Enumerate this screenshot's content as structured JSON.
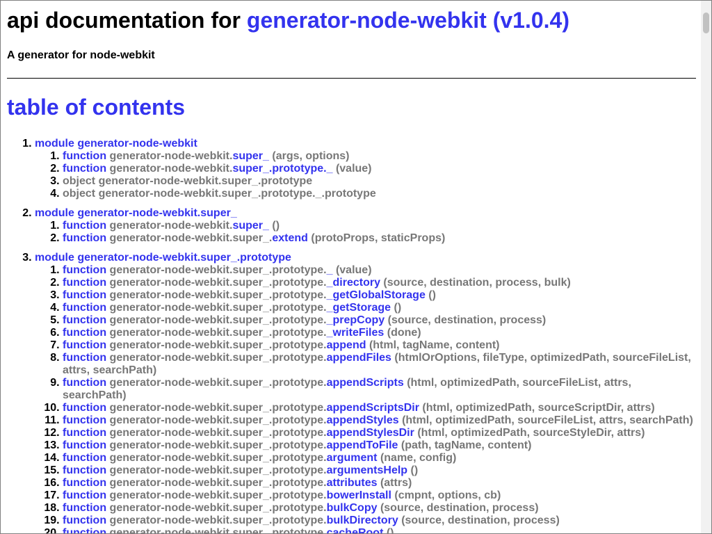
{
  "header": {
    "title_prefix": "api documentation for ",
    "title_link": "generator-node-webkit (v1.0.4)",
    "description": "A generator for node-webkit"
  },
  "toc": {
    "title": "table of contents",
    "modules": [
      {
        "label": "module generator-node-webkit",
        "items": [
          {
            "kind": "function",
            "prefix": "generator-node-webkit.",
            "name": "super_",
            "args": "(args, options)"
          },
          {
            "kind": "function",
            "prefix": "generator-node-webkit.",
            "name": "super_.prototype._",
            "args": "(value)"
          },
          {
            "kind": "object",
            "prefix": "generator-node-webkit.super_.prototype",
            "name": "",
            "args": ""
          },
          {
            "kind": "object",
            "prefix": "generator-node-webkit.super_.prototype._.prototype",
            "name": "",
            "args": ""
          }
        ]
      },
      {
        "label": "module generator-node-webkit.super_",
        "items": [
          {
            "kind": "function",
            "prefix": "generator-node-webkit.",
            "name": "super_",
            "args": "()"
          },
          {
            "kind": "function",
            "prefix": "generator-node-webkit.super_.",
            "name": "extend",
            "args": "(protoProps, staticProps)"
          }
        ]
      },
      {
        "label": "module generator-node-webkit.super_.prototype",
        "items": [
          {
            "kind": "function",
            "prefix": "generator-node-webkit.super_.prototype.",
            "name": "_",
            "args": "(value)"
          },
          {
            "kind": "function",
            "prefix": "generator-node-webkit.super_.prototype.",
            "name": "_directory",
            "args": "(source, destination, process, bulk)"
          },
          {
            "kind": "function",
            "prefix": "generator-node-webkit.super_.prototype.",
            "name": "_getGlobalStorage",
            "args": "()"
          },
          {
            "kind": "function",
            "prefix": "generator-node-webkit.super_.prototype.",
            "name": "_getStorage",
            "args": "()"
          },
          {
            "kind": "function",
            "prefix": "generator-node-webkit.super_.prototype.",
            "name": "_prepCopy",
            "args": "(source, destination, process)"
          },
          {
            "kind": "function",
            "prefix": "generator-node-webkit.super_.prototype.",
            "name": "_writeFiles",
            "args": "(done)"
          },
          {
            "kind": "function",
            "prefix": "generator-node-webkit.super_.prototype.",
            "name": "append",
            "args": "(html, tagName, content)"
          },
          {
            "kind": "function",
            "prefix": "generator-node-webkit.super_.prototype.",
            "name": "appendFiles",
            "args": "(htmlOrOptions, fileType, optimizedPath, sourceFileList, attrs, searchPath)"
          },
          {
            "kind": "function",
            "prefix": "generator-node-webkit.super_.prototype.",
            "name": "appendScripts",
            "args": "(html, optimizedPath, sourceFileList, attrs, searchPath)"
          },
          {
            "kind": "function",
            "prefix": "generator-node-webkit.super_.prototype.",
            "name": "appendScriptsDir",
            "args": "(html, optimizedPath, sourceScriptDir, attrs)"
          },
          {
            "kind": "function",
            "prefix": "generator-node-webkit.super_.prototype.",
            "name": "appendStyles",
            "args": "(html, optimizedPath, sourceFileList, attrs, searchPath)"
          },
          {
            "kind": "function",
            "prefix": "generator-node-webkit.super_.prototype.",
            "name": "appendStylesDir",
            "args": "(html, optimizedPath, sourceStyleDir, attrs)"
          },
          {
            "kind": "function",
            "prefix": "generator-node-webkit.super_.prototype.",
            "name": "appendToFile",
            "args": "(path, tagName, content)"
          },
          {
            "kind": "function",
            "prefix": "generator-node-webkit.super_.prototype.",
            "name": "argument",
            "args": "(name, config)"
          },
          {
            "kind": "function",
            "prefix": "generator-node-webkit.super_.prototype.",
            "name": "argumentsHelp",
            "args": "()"
          },
          {
            "kind": "function",
            "prefix": "generator-node-webkit.super_.prototype.",
            "name": "attributes",
            "args": "(attrs)"
          },
          {
            "kind": "function",
            "prefix": "generator-node-webkit.super_.prototype.",
            "name": "bowerInstall",
            "args": "(cmpnt, options, cb)"
          },
          {
            "kind": "function",
            "prefix": "generator-node-webkit.super_.prototype.",
            "name": "bulkCopy",
            "args": "(source, destination, process)"
          },
          {
            "kind": "function",
            "prefix": "generator-node-webkit.super_.prototype.",
            "name": "bulkDirectory",
            "args": "(source, destination, process)"
          },
          {
            "kind": "function",
            "prefix": "generator-node-webkit.super_.prototype.",
            "name": "cacheRoot",
            "args": "()"
          }
        ]
      }
    ]
  }
}
